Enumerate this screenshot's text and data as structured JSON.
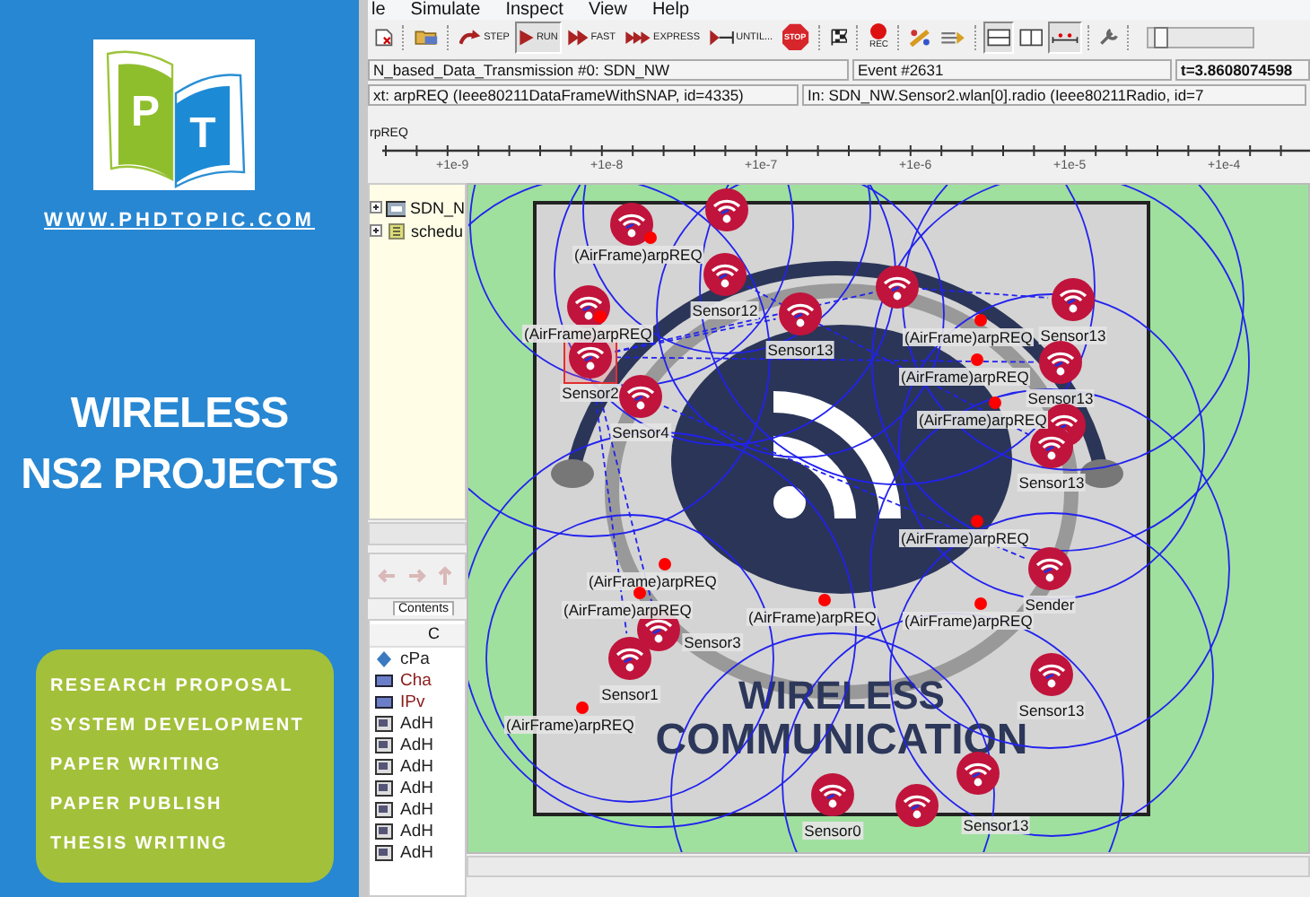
{
  "promo": {
    "logo_letters": [
      "P",
      "T"
    ],
    "url": "WWW.PHDTOPIC.COM",
    "title_lines": [
      "WIRELESS",
      "NS2 PROJECTS"
    ],
    "services": [
      "RESEARCH PROPOSAL",
      "SYSTEM DEVELOPMENT",
      "PAPER WRITING",
      "PAPER PUBLISH",
      "THESIS WRITING"
    ]
  },
  "app": {
    "menu": [
      "le",
      "Simulate",
      "Inspect",
      "View",
      "Help"
    ],
    "toolbar": [
      {
        "kind": "new",
        "pressed": false
      },
      {
        "kind": "separator"
      },
      {
        "kind": "open",
        "pressed": false
      },
      {
        "kind": "separator"
      },
      {
        "kind": "step",
        "label": "STEP",
        "pressed": false
      },
      {
        "kind": "run",
        "label": "RUN",
        "pressed": true
      },
      {
        "kind": "fast",
        "label": "FAST",
        "pressed": false
      },
      {
        "kind": "express",
        "label": "EXPRESS",
        "pressed": false
      },
      {
        "kind": "until",
        "label": "UNTIL...",
        "pressed": false
      },
      {
        "kind": "stop",
        "label": "STOP",
        "pressed": false
      },
      {
        "kind": "separator"
      },
      {
        "kind": "finish",
        "pressed": false
      },
      {
        "kind": "separator"
      },
      {
        "kind": "record",
        "label": "REC",
        "pressed": false
      },
      {
        "kind": "separator"
      },
      {
        "kind": "rebuild",
        "pressed": false
      },
      {
        "kind": "arrange",
        "pressed": false
      },
      {
        "kind": "separator"
      },
      {
        "kind": "split_horizontal",
        "pressed": true
      },
      {
        "kind": "split_vertical",
        "pressed": false
      },
      {
        "kind": "timeline",
        "pressed": true
      },
      {
        "kind": "separator"
      },
      {
        "kind": "options",
        "pressed": false
      },
      {
        "kind": "separator"
      }
    ],
    "speed_slider": {
      "level": 0.06
    },
    "status": {
      "network": "N_based_Data_Transmission #0: SDN_NW",
      "event": "Event #2631",
      "time": "t=3.8608074598"
    },
    "message_row": {
      "next": "xt: arpREQ (Ieee80211DataFrameWithSNAP, id=4335)",
      "module": "In: SDN_NW.Sensor2.wlan[0].radio (Ieee80211Radio, id=7"
    },
    "timeline": {
      "message": "rpREQ",
      "ticks": [
        "+1e-9",
        "+1e-8",
        "+1e-7",
        "+1e-6",
        "+1e-5",
        "+1e-4"
      ]
    },
    "tree": [
      {
        "label": "SDN_N",
        "kind": "network"
      },
      {
        "label": "schedu",
        "kind": "scheduler"
      }
    ],
    "contents_tab": "Contents",
    "contents_column": "C",
    "contents_list": [
      {
        "label": "cPa",
        "kind": "parameter"
      },
      {
        "label": "Cha",
        "kind": "object"
      },
      {
        "label": "IPv",
        "kind": "object"
      },
      {
        "label": "AdH",
        "kind": "module"
      },
      {
        "label": "AdH",
        "kind": "module"
      },
      {
        "label": "AdH",
        "kind": "module"
      },
      {
        "label": "AdH",
        "kind": "module"
      },
      {
        "label": "AdH",
        "kind": "module"
      },
      {
        "label": "AdH",
        "kind": "module"
      },
      {
        "label": "AdH",
        "kind": "module"
      }
    ],
    "canvas": {
      "background_caption": [
        "WIRELESS",
        "COMMUNICATION"
      ],
      "nodes": [
        {
          "selected": false
        },
        {
          "selected": false
        },
        {
          "label": "Sensor12",
          "selected": false
        },
        {
          "selected": false
        },
        {
          "label": "Sensor2",
          "selected": true
        },
        {
          "label": "Sensor4",
          "selected": false
        },
        {
          "selected": false
        },
        {
          "label": "Sensor13",
          "selected": false
        },
        {
          "label": "Sensor13",
          "selected": false
        },
        {
          "label": "Sensor13",
          "selected": false
        },
        {
          "selected": false
        },
        {
          "label": "Sensor13",
          "selected": false
        },
        {
          "label": "Sender",
          "selected": false
        },
        {
          "label": "Sensor13",
          "selected": false
        },
        {
          "label": "Sensor3",
          "selected": false
        },
        {
          "label": "Sensor1",
          "selected": false
        },
        {
          "label": "Sensor0",
          "selected": false
        },
        {
          "selected": false
        },
        {
          "label": "Sensor13",
          "selected": false
        }
      ],
      "messages": [
        {
          "label": "(AirFrame)arpREQ"
        },
        {
          "label": "(AirFrame)arpREQ"
        },
        {
          "label": "(AirFrame)arpREQ"
        },
        {
          "label": "(AirFrame)arpREQ"
        },
        {
          "label": "(AirFrame)arpREQ"
        },
        {
          "label": "(AirFrame)arpREQ"
        },
        {
          "label": "(AirFrame)arpREQ"
        },
        {
          "label": "(AirFrame)arpREQ"
        },
        {
          "label": "(AirFrame)arpREQ"
        },
        {
          "label": "(AirFrame)arpREQ"
        },
        {
          "label": "(AirFrame)arpREQ"
        }
      ]
    }
  }
}
